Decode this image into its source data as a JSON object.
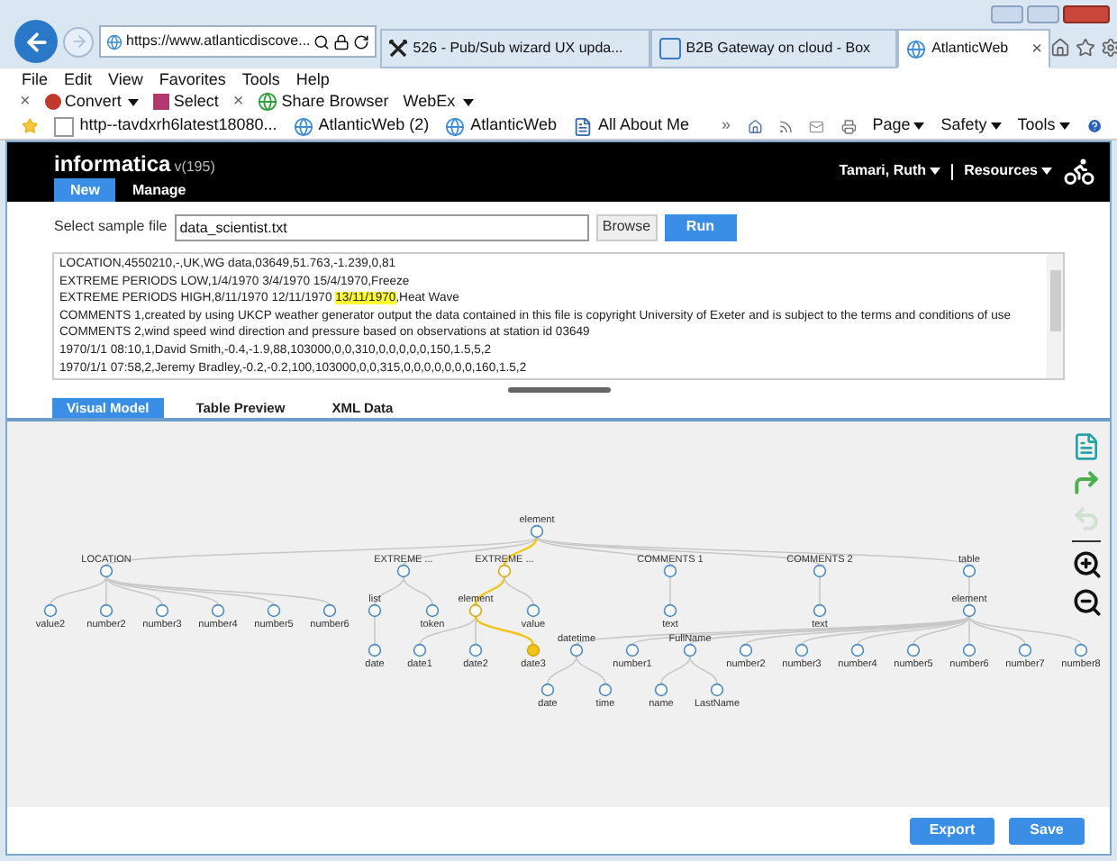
{
  "browser": {
    "address": "https://www.atlanticdiscove...",
    "tabs": [
      {
        "title": "526 - Pub/Sub wizard UX upda...",
        "selected": false,
        "kind": "tool"
      },
      {
        "title": "B2B Gateway on cloud - Box",
        "selected": false,
        "kind": "box"
      },
      {
        "title": "AtlanticWeb",
        "selected": true,
        "kind": "web",
        "close": "×"
      }
    ],
    "menu": [
      "File",
      "Edit",
      "View",
      "Favorites",
      "Tools",
      "Help"
    ],
    "toolbar": [
      {
        "kind": "close",
        "label": "×"
      },
      {
        "kind": "convert",
        "label": "Convert",
        "dropdown": true
      },
      {
        "kind": "select",
        "label": "Select",
        "dropdown": false
      },
      {
        "kind": "close",
        "label": "×"
      },
      {
        "kind": "share",
        "label": "Share Browser",
        "dropdown": false
      },
      {
        "kind": "plain",
        "label": "WebEx",
        "dropdown": true
      }
    ],
    "favorites": [
      {
        "kind": "page",
        "label": "http--tavdxrh6latest18080..."
      },
      {
        "kind": "web",
        "label": "AtlanticWeb (2)"
      },
      {
        "kind": "web",
        "label": "AtlanticWeb"
      },
      {
        "kind": "word",
        "label": "All About Me"
      }
    ],
    "overflow": "»",
    "commands": [
      "Page",
      "Safety",
      "Tools"
    ]
  },
  "app": {
    "logo": "informatica",
    "version": "v(195)",
    "nav_tabs": [
      {
        "label": "New",
        "selected": true
      },
      {
        "label": "Manage",
        "selected": false
      }
    ],
    "user": "Tamari, Ruth",
    "resources": "Resources"
  },
  "sample_file": {
    "label": "Select sample file",
    "value": "data_scientist.txt",
    "buttons": [
      {
        "label": "Browse",
        "kind": "secondary"
      },
      {
        "label": "Run",
        "kind": "primary"
      }
    ]
  },
  "preview_lines": [
    {
      "text": "LOCATION,4550210,-,UK,WG data,03649,51.763,-1.239,0,81"
    },
    {
      "text": "EXTREME PERIODS LOW,1/4/1970 3/4/1970 15/4/1970,Freeze"
    },
    {
      "text": "EXTREME PERIODS HIGH,8/11/1970 12/11/1970 ",
      "highlight": "13/11/1970",
      "after": ",Heat Wave"
    },
    {
      "text": "COMMENTS 1,created by using UKCP weather generator output the data contained in this file is copyright University of Exeter and is subject to the terms and conditions of use"
    },
    {
      "text": "COMMENTS 2,wind speed wind direction and pressure based on observations at station id 03649"
    },
    {
      "text": "1970/1/1 08:10,1,David Smith,-0.4,-1.9,88,103000,0,0,310,0,0,0,0,0,150,1.5,5,2"
    },
    {
      "text": "1970/1/1 07:58,2,Jeremy Bradley,-0.2,-0.2,100,103000,0,0,315,0,0,0,0,0,0,0,160,1.5,2"
    }
  ],
  "view_tabs": [
    {
      "label": "Visual Model",
      "selected": true
    },
    {
      "label": "Table Preview",
      "selected": false
    },
    {
      "label": "XML Data",
      "selected": false
    }
  ],
  "tree": {
    "label": "element",
    "highlighted": false,
    "children": [
      {
        "label": "LOCATION",
        "highlighted": false,
        "children": [
          {
            "label": "value2",
            "highlighted": false
          },
          {
            "label": "number2",
            "highlighted": false
          },
          {
            "label": "number3",
            "highlighted": false
          },
          {
            "label": "number4",
            "highlighted": false
          },
          {
            "label": "number5",
            "highlighted": false
          },
          {
            "label": "number6",
            "highlighted": false
          }
        ]
      },
      {
        "label": "EXTREME ...",
        "highlighted": false,
        "children": [
          {
            "label": "list",
            "highlighted": false,
            "children": [
              {
                "label": "date",
                "highlighted": false
              }
            ]
          },
          {
            "label": "token",
            "highlighted": false
          }
        ]
      },
      {
        "label": "EXTREME ...",
        "highlighted": true,
        "children": [
          {
            "label": "element",
            "highlighted": true,
            "children": [
              {
                "label": "date1",
                "highlighted": false
              },
              {
                "label": "date2",
                "highlighted": false
              },
              {
                "label": "date3",
                "highlighted": true
              }
            ]
          },
          {
            "label": "value",
            "highlighted": false
          }
        ]
      },
      {
        "label": "COMMENTS 1",
        "highlighted": false,
        "children": [
          {
            "label": "text",
            "highlighted": false
          }
        ]
      },
      {
        "label": "COMMENTS 2",
        "highlighted": false,
        "children": [
          {
            "label": "text",
            "highlighted": false
          }
        ]
      },
      {
        "label": "table",
        "highlighted": false,
        "children": [
          {
            "label": "element",
            "highlighted": false,
            "children": [
              {
                "label": "datetime",
                "highlighted": false,
                "children": [
                  {
                    "label": "date",
                    "highlighted": false
                  },
                  {
                    "label": "time",
                    "highlighted": false
                  }
                ]
              },
              {
                "label": "number1",
                "highlighted": false
              },
              {
                "label": "FullName",
                "highlighted": false,
                "children": [
                  {
                    "label": "name",
                    "highlighted": false
                  },
                  {
                    "label": "LastName",
                    "highlighted": false
                  }
                ]
              },
              {
                "label": "number2",
                "highlighted": false
              },
              {
                "label": "number3",
                "highlighted": false
              },
              {
                "label": "number4",
                "highlighted": false
              },
              {
                "label": "number5",
                "highlighted": false
              },
              {
                "label": "number6",
                "highlighted": false
              },
              {
                "label": "number7",
                "highlighted": false
              },
              {
                "label": "number8",
                "highlighted": false
              }
            ]
          }
        ]
      }
    ]
  },
  "tools": [
    {
      "kind": "document",
      "disabled": false
    },
    {
      "kind": "redo",
      "disabled": false
    },
    {
      "kind": "undo",
      "disabled": true
    },
    {
      "kind": "zoom-in",
      "disabled": false
    },
    {
      "kind": "zoom-out",
      "disabled": false
    }
  ],
  "footer_buttons": [
    "Export",
    "Save"
  ]
}
